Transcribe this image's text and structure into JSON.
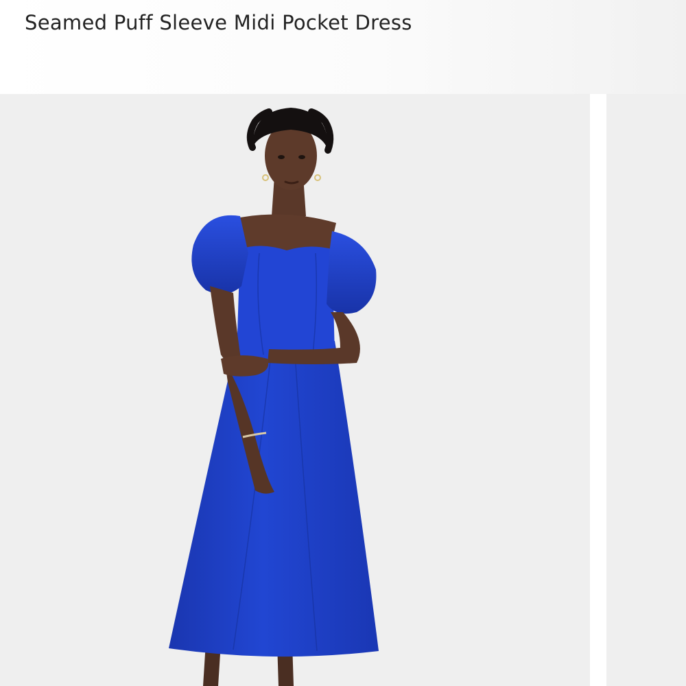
{
  "product": {
    "title": "Seamed Puff Sleeve Midi Pocket Dress"
  },
  "gallery": {
    "main_image": {
      "dress_color": "#1f40c8",
      "background_color": "#efefef"
    },
    "next_image": {
      "background_color": "#efefef"
    }
  }
}
